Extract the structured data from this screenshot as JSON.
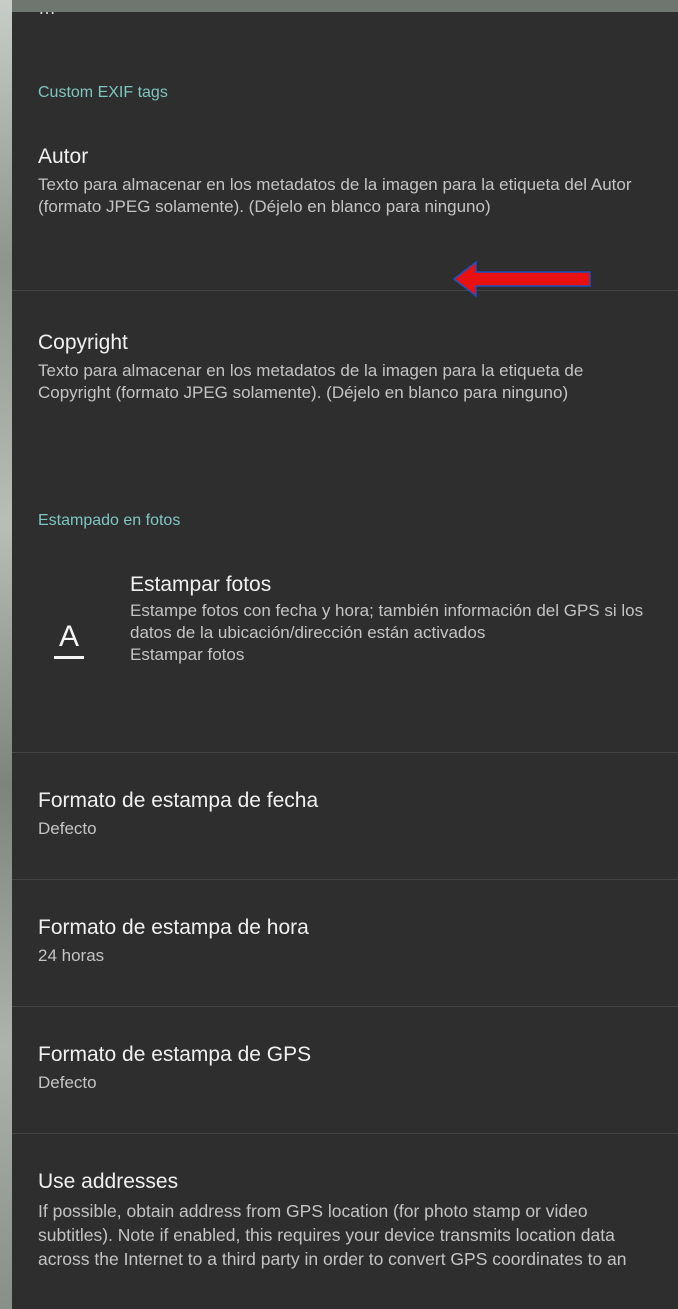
{
  "sections": {
    "exif_header": "Custom EXIF tags",
    "stamp_header": "Estampado en fotos"
  },
  "prefs": {
    "author": {
      "title": "Autor",
      "summary": "Texto para almacenar en los metadatos de la imagen para la etiqueta del Autor (formato JPEG solamente). (Déjelo en blanco para ninguno)"
    },
    "copyright": {
      "title": "Copyright",
      "summary": "Texto para almacenar en los metadatos de la imagen para la etiqueta de Copyright (formato JPEG solamente). (Déjelo en blanco para ninguno)"
    },
    "stamp_photos": {
      "title": "Estampar fotos",
      "summary": "Estampe fotos con fecha y hora; también información del GPS si los datos de la ubicación/dirección están activados",
      "value": "Estampar fotos",
      "icon": "text-format-icon"
    },
    "date_format": {
      "title": "Formato de estampa de fecha",
      "value": "Defecto"
    },
    "time_format": {
      "title": "Formato de estampa de hora",
      "value": "24 horas"
    },
    "gps_format": {
      "title": "Formato de estampa de GPS",
      "value": "Defecto"
    },
    "use_addresses": {
      "title": "Use addresses",
      "summary": "If possible, obtain address from GPS location (for photo stamp or video subtitles). Note if enabled, this requires your device transmits location data across the Internet to a third party in order to convert GPS coordinates to an"
    }
  },
  "annotation": {
    "arrow_color": "#e8110f",
    "arrow_icon": "arrow-left-icon"
  },
  "colors": {
    "background": "#2e2e2e",
    "accent": "#7fc6c0",
    "title": "#f0f0f0",
    "summary": "#c4c4c4"
  }
}
